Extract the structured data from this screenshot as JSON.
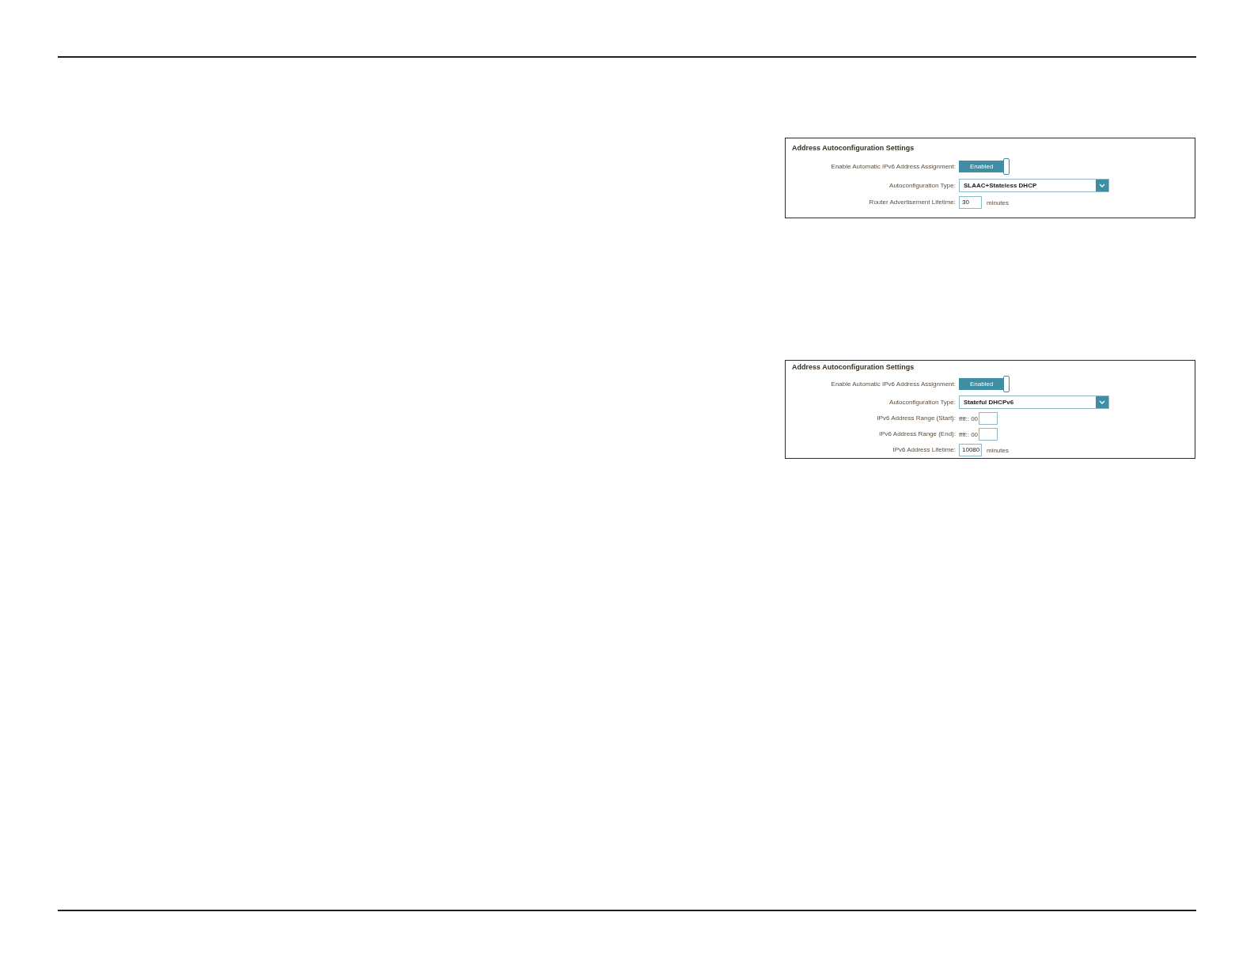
{
  "panels": [
    {
      "title": "Address Autoconfiguration Settings",
      "fields": [
        {
          "kind": "toggle",
          "label": "Enable Automatic IPv6 Address Assignment:",
          "on": true,
          "text": "Enabled"
        },
        {
          "kind": "select",
          "label": "Autoconfiguration Type:",
          "value": "SLAAC+Stateless DHCP"
        },
        {
          "kind": "input",
          "label": "Router Advertisement Lifetime:",
          "value": "30",
          "unit": "minutes"
        }
      ]
    },
    {
      "title": "Address Autoconfiguration Settings",
      "fields": [
        {
          "kind": "toggle",
          "label": "Enable Automatic IPv6 Address Assignment:",
          "on": true,
          "text": "Enabled"
        },
        {
          "kind": "select",
          "label": "Autoconfiguration Type:",
          "value": "Stateful DHCPv6"
        },
        {
          "kind": "input",
          "label": "IPv6 Address Range (Start):",
          "prefix": "ffff:: 00"
        },
        {
          "kind": "input",
          "label": "IPv6 Address Range (End):",
          "prefix": "ffff:: 00"
        },
        {
          "kind": "input",
          "label": "IPv6 Address Lifetime:",
          "value": "10080",
          "unit": "minutes"
        }
      ]
    }
  ]
}
